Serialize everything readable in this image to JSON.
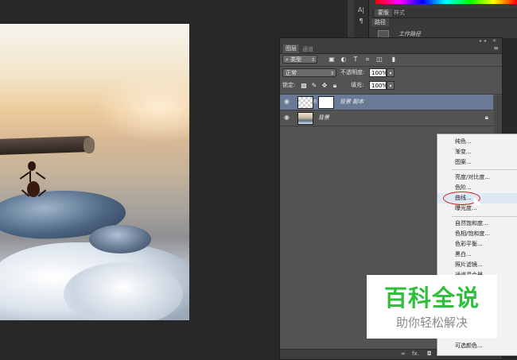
{
  "top_panel": {
    "tabs": [
      "蒙版",
      "样式"
    ],
    "path_tab": "路径",
    "path_name": "工作路径"
  },
  "layers_panel": {
    "tabs": [
      "图层",
      "通道"
    ],
    "filter_kind": "类型",
    "blend_mode": "正常",
    "opacity_label": "不透明度:",
    "opacity_value": "100%",
    "lock_label": "锁定:",
    "fill_label": "填充:",
    "fill_value": "100%",
    "layers": [
      {
        "name": "背景 副本",
        "selected": true
      },
      {
        "name": "背景",
        "selected": false
      }
    ],
    "footer_fx": "fx."
  },
  "context_menu": {
    "items": [
      "纯色...",
      "渐变...",
      "图案...",
      "亮度/对比度...",
      "色阶...",
      "曲线...",
      "曝光度...",
      "自然饱和度...",
      "色相/饱和度...",
      "色彩平衡...",
      "黑白...",
      "照片滤镜...",
      "通道混合器...",
      "可选颜色..."
    ],
    "hovered": "曲线..."
  },
  "watermark": {
    "title": "百科全说",
    "subtitle": "助你轻松解决"
  }
}
